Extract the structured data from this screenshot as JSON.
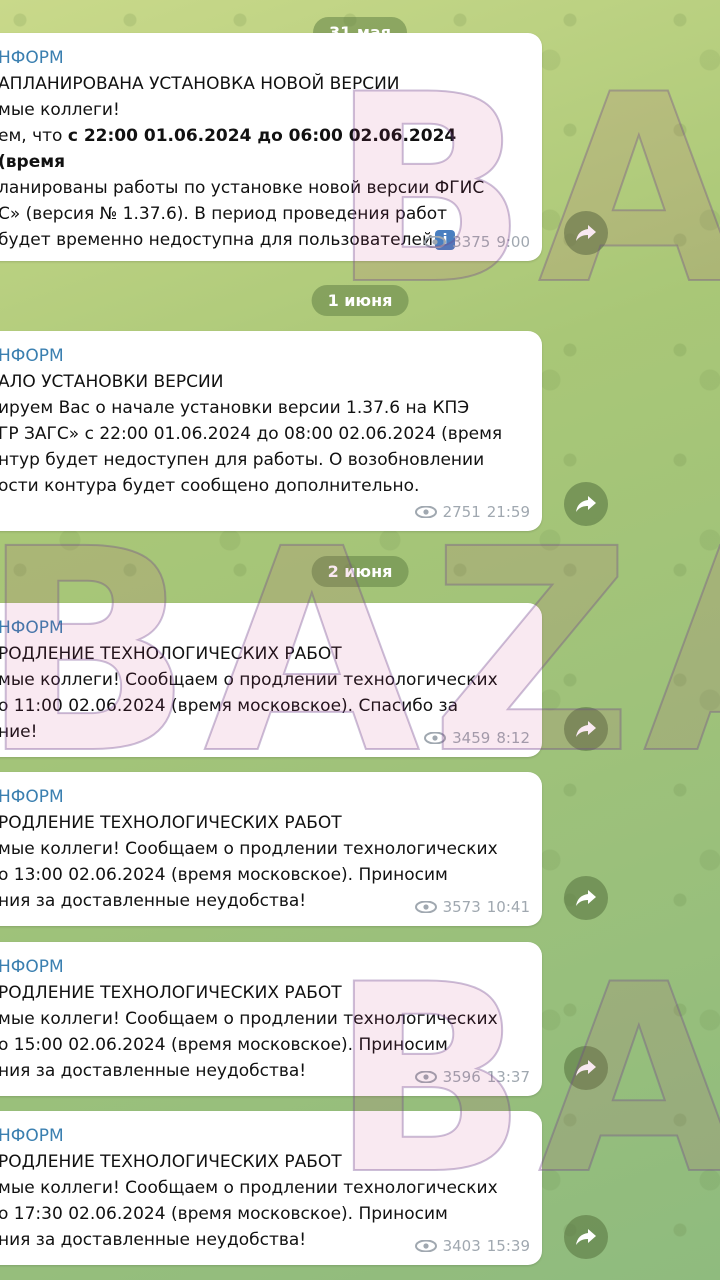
{
  "watermark": "BAZA",
  "dates": [
    "31 мая",
    "1 июня",
    "2 июня"
  ],
  "messages": [
    {
      "sender": "НФОРМ",
      "title": "АПЛАНИРОВАНА УСТАНОВКА НОВОЙ ВЕРСИИ",
      "line1": "мые коллеги!",
      "line2a": "ем, что ",
      "line2b": "с 22:00 01.06.2024 до 06:00 02.06.2024 (время",
      "line3": "ланированы работы по установке новой версии ФГИС",
      "line4": "С» (версия № 1.37.6). В период проведения работ",
      "line5": "будет временно недоступна для пользователей",
      "views": "3375",
      "time": "9:00"
    },
    {
      "sender": "НФОРМ",
      "title": "АЛО УСТАНОВКИ ВЕРСИИ",
      "line1": "ируем Вас о начале установки версии 1.37.6 на КПЭ",
      "line2": "ГР ЗАГС» с 22:00 01.06.2024 до 08:00 02.06.2024 (время",
      "line3": "нтур будет недоступен для работы. О возобновлении",
      "line4": "ости контура будет сообщено дополнительно.",
      "views": "2751",
      "time": "21:59"
    },
    {
      "sender": "НФОРМ",
      "title": "РОДЛЕНИЕ ТЕХНОЛОГИЧЕСКИХ РАБОТ",
      "line1": "мые коллеги! Сообщаем о продлении технологических",
      "line2": "о 11:00  02.06.2024 (время московское). Спасибо за",
      "line3": "ние!",
      "views": "3459",
      "time": "8:12"
    },
    {
      "sender": "НФОРМ",
      "title": "РОДЛЕНИЕ ТЕХНОЛОГИЧЕСКИХ РАБОТ",
      "line1": "мые коллеги! Сообщаем о продлении технологических",
      "line2": "о 13:00  02.06.2024 (время московское). Приносим",
      "line3": "ния за доставленные неудобства!",
      "views": "3573",
      "time": "10:41"
    },
    {
      "sender": "НФОРМ",
      "title": "РОДЛЕНИЕ ТЕХНОЛОГИЧЕСКИХ РАБОТ",
      "line1": "мые коллеги! Сообщаем о продлении технологических",
      "line2": "о 15:00  02.06.2024 (время московское). Приносим",
      "line3": "ния за доставленные неудобства!",
      "views": "3596",
      "time": "13:37"
    },
    {
      "sender": "НФОРМ",
      "title": "РОДЛЕНИЕ ТЕХНОЛОГИЧЕСКИХ РАБОТ",
      "line1": "мые коллеги! Сообщаем о продлении технологических",
      "line2": "о 17:30  02.06.2024 (время московское). Приносим",
      "line3": "ния за доставленные неудобства!",
      "views": "3403",
      "time": "15:39"
    }
  ],
  "icons": {
    "views": "eye-icon",
    "share": "share-icon",
    "info": "info-icon"
  },
  "colors": {
    "sender": "#3a7fb0",
    "meta": "#a0a8b0",
    "bubble": "#ffffff"
  }
}
